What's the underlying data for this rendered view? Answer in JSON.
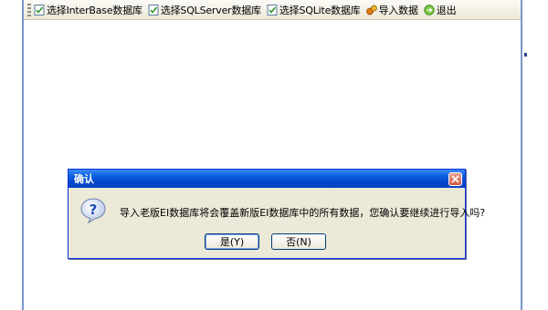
{
  "toolbar": {
    "items": [
      {
        "label": "选择InterBase数据库",
        "icon": "checked-document-icon"
      },
      {
        "label": "选择SQLServer数据库",
        "icon": "checked-document-icon"
      },
      {
        "label": "选择SQLite数据库",
        "icon": "checked-document-icon"
      },
      {
        "label": "导入数据",
        "icon": "import-data-icon"
      },
      {
        "label": "退出",
        "icon": "exit-icon"
      }
    ]
  },
  "dialog": {
    "title": "确认",
    "icon": "question-icon",
    "message": "导入老版EI数据库将会覆盖新版EI数据库中的所有数据，您确认要继续进行导入吗?",
    "yes_label": "是(Y)",
    "no_label": "否(N)"
  },
  "colors": {
    "titlebar": "#0a5fe0",
    "dialog_bg": "#ece9d8",
    "window_border": "#7a96c9"
  }
}
